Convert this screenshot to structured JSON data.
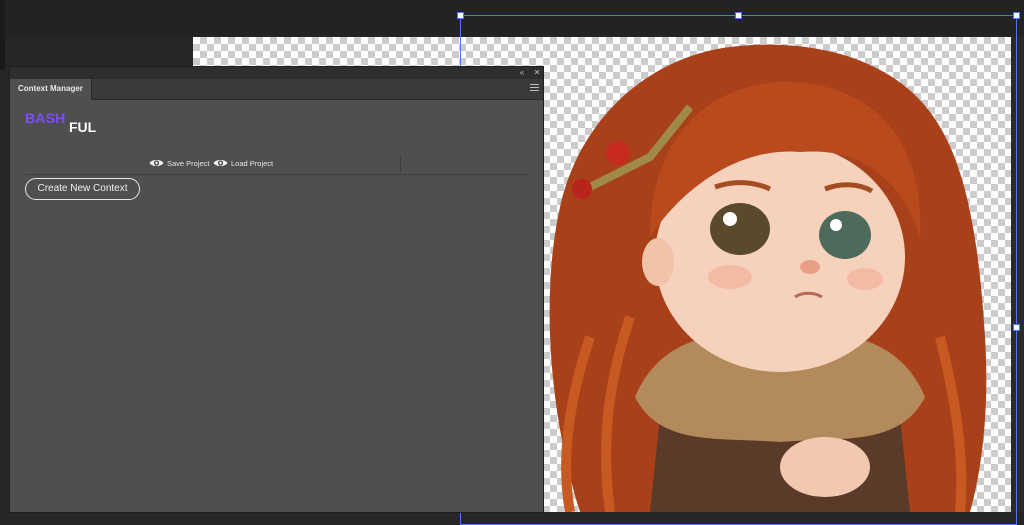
{
  "panel": {
    "tab_label": "Context Manager",
    "collapse_glyph": "«",
    "close_glyph": "✕",
    "logo": {
      "part1": "BASH",
      "part2": "FUL"
    },
    "save_project_label": "Save Project",
    "load_project_label": "Load Project",
    "create_context_label": "Create New Context"
  },
  "icons": {
    "save": "eye-icon",
    "load": "eye-icon",
    "menu": "hamburger-menu-icon"
  },
  "colors": {
    "panel_bg": "#4f4f4f",
    "logo_accent": "#7b4dff",
    "selection": "#4a78ff"
  }
}
